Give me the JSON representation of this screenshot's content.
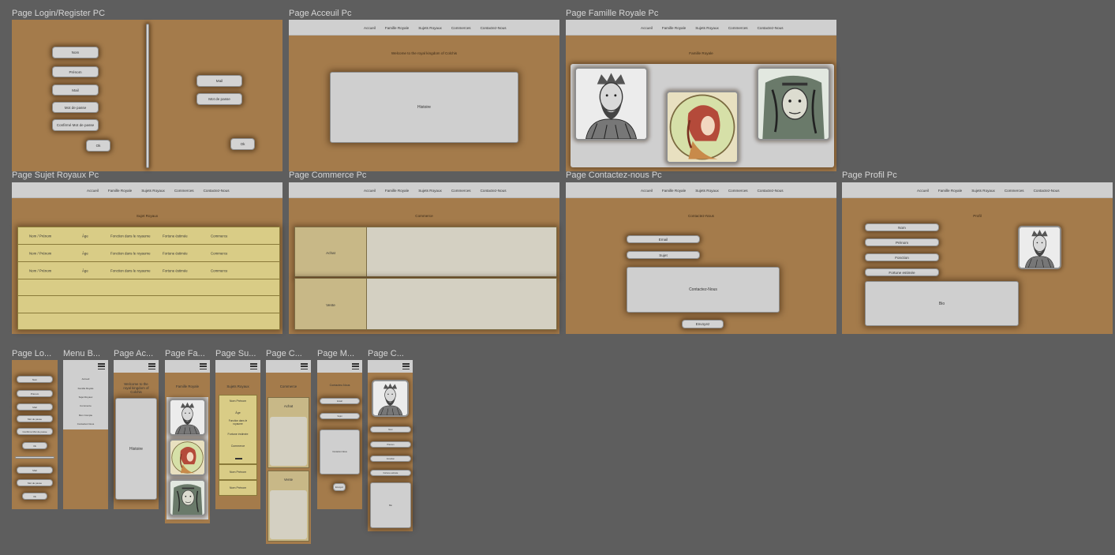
{
  "titles": {
    "login_pc": "Page Login/Register PC",
    "accueil_pc": "Page Acceuil Pc",
    "famille_pc": "Page Famille Royale Pc",
    "sujets_pc": "Page Sujet Royaux Pc",
    "commerce_pc": "Page Commerce Pc",
    "contact_pc": "Page Contactez-nous Pc",
    "profil_pc": "Page Profil Pc",
    "m_login": "Page Lo...",
    "m_menu": "Menu B...",
    "m_accueil": "Page Ac...",
    "m_famille": "Page Fa...",
    "m_sujets": "Page Su...",
    "m_commerce": "Page C...",
    "m_message": "Page M...",
    "m_compte": "Page C..."
  },
  "nav": {
    "accueil": "Accueil",
    "famille": "Famille Royale",
    "sujets": "Sujets Royaux",
    "commerces": "Commerces",
    "contact": "Contactez-Nous"
  },
  "login": {
    "nom": "Nom",
    "prenom": "Prénom",
    "mail": "Mail",
    "mdp": "Mot de passe",
    "confirm": "Confirmé Mot de passe",
    "ok": "Ok",
    "mail2": "Mail",
    "mdp2": "Mot de passe",
    "ok2": "Ok"
  },
  "accueil": {
    "welcome": "Welcome to the royal kingdom of Colchis",
    "histoire": "Histoire"
  },
  "famille": {
    "title": "Famille Royale"
  },
  "sujets": {
    "title": "Sujet Royaux",
    "rows": [
      {
        "nom": "Nom / Prénom",
        "age": "Âge",
        "fonction": "Fonction dans le royaume",
        "fortune": "Fortune éstimée",
        "commerce": "Commerce"
      },
      {
        "nom": "Nom / Prénom",
        "age": "Âge",
        "fonction": "Fonction dans le royaume",
        "fortune": "Fortune éstimée",
        "commerce": "Commerce"
      },
      {
        "nom": "Nom / Prénom",
        "age": "Âge",
        "fonction": "Fonction dans le royaume",
        "fortune": "Fortune éstimée",
        "commerce": "Commerce"
      }
    ]
  },
  "commerce": {
    "title": "Commerce",
    "achat": "Achat",
    "vente": "Vente"
  },
  "contact": {
    "title": "Contactez-Nous",
    "email": "Email",
    "sujet": "Sujet",
    "message": "Contactez-Nous",
    "envoyez": "Envoyez"
  },
  "profil": {
    "title": "Profil",
    "nom": "Nom",
    "prenom": "Prénom",
    "fonction": "Fonction",
    "fortune": "Fortune estimée",
    "bio": "Bio"
  },
  "mobile": {
    "login": {
      "nom": "Nom",
      "prenom": "Prénom",
      "mail": "Mail",
      "mdp": "Mot de passe",
      "confirm": "Confirmé Mot de passe",
      "ok": "Ok",
      "mail2": "Mail",
      "mdp2": "Mot de passe",
      "ok2": "Ok"
    },
    "menu": [
      "Accueil",
      "Famille Royale",
      "Sujet Royaux",
      "Commerce",
      "Mon Compte",
      "Contactez-Nous"
    ],
    "accueil": {
      "welcome": "Welcome to the royal kingdom of Colchis",
      "histoire": "Histoire"
    },
    "famille": {
      "title": "Famille Royale"
    },
    "sujets": {
      "title": "Sujets Royaux",
      "nom": "Nom Prénom",
      "age": "Âge",
      "fonction": "Fonction dans le royaume",
      "fortune": "Fortune éstimée",
      "commerce": "Commerce",
      "row2": "Nom Prénom",
      "row3": "Nom Prénom"
    },
    "commerce": {
      "title": "Commerce",
      "achat": "Achat",
      "vente": "Vente"
    },
    "message": {
      "title": "Contactez-Nous",
      "email": "Email",
      "sujet": "Sujet",
      "message": "Contactez-Nous",
      "envoyez": "Envoyez"
    },
    "compte": {
      "nom": "Nom",
      "prenom": "Prénom",
      "fonction": "Fonction",
      "fortune": "Fortune estimée",
      "bio": "Bio"
    }
  },
  "colors": {
    "canvas": "#5e5e5e",
    "page_bg": "#a47b4b",
    "nav_bg": "#cfcfcf",
    "table_bg": "#d9cc86",
    "commerce_bg": "#c8b887"
  }
}
